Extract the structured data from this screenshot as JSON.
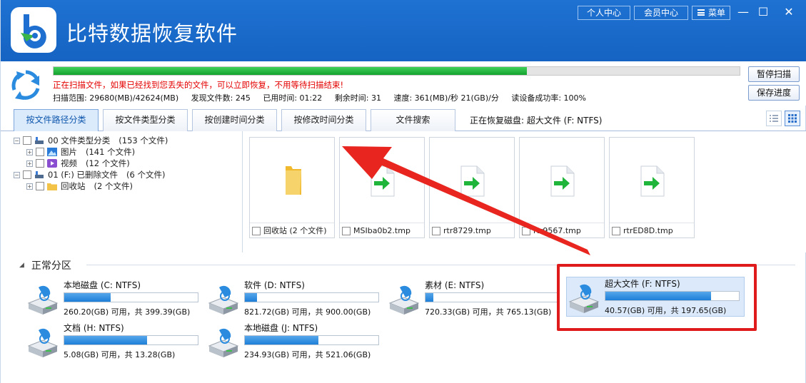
{
  "app": {
    "title": "比特数据恢复软件",
    "buttons": {
      "personal": "个人中心",
      "member": "会员中心",
      "menu": "菜单"
    }
  },
  "scan": {
    "progress": 0.69,
    "message": "正在扫描文件，如果已经找到您丢失的文件，可以立即恢复，不用等待扫描结束!",
    "stats": [
      "扫描范围: 29680(MB)/42624(MB)",
      "发现文件数: 245",
      "已用时间: 01:22",
      "剩余时间: 31",
      "速度: 361(MB)/秒  21(GB)/分",
      "读设备成功率: 100%"
    ],
    "pause_label": "暂停扫描",
    "save_label": "保存进度"
  },
  "tabs": [
    {
      "label": "按文件路径分类",
      "active": true
    },
    {
      "label": "按文件类型分类",
      "active": false
    },
    {
      "label": "按创建时间分类",
      "active": false
    },
    {
      "label": "按修改时间分类",
      "active": false
    },
    {
      "label": "文件搜索",
      "active": false
    }
  ],
  "recovering_text": "正在恢复磁盘: 超大文件 (F: NTFS)",
  "tree": [
    {
      "label": "00 文件类型分类",
      "count": "(153 个文件)",
      "icon": "drive-icon",
      "level": 0
    },
    {
      "label": "图片",
      "count": "(141 个文件)",
      "icon": "picture-icon",
      "level": 1
    },
    {
      "label": "视频",
      "count": "(12 个文件)",
      "icon": "video-icon",
      "level": 1
    },
    {
      "label": "01 (F:) 已删除文件",
      "count": "(6 个文件)",
      "icon": "drive-icon",
      "level": 0
    },
    {
      "label": "回收站",
      "count": "(2 个文件)",
      "icon": "folder-icon",
      "level": 1
    }
  ],
  "files": [
    {
      "name": "回收站 (2 个文件)",
      "icon": "folder-icon"
    },
    {
      "name": "MSIba0b2.tmp",
      "icon": "file-arrow-icon"
    },
    {
      "name": "rtr8729.tmp",
      "icon": "file-arrow-icon"
    },
    {
      "name": "rtr9567.tmp",
      "icon": "file-arrow-icon"
    },
    {
      "name": "rtrED8D.tmp",
      "icon": "file-arrow-icon"
    }
  ],
  "partitions": {
    "header": "正常分区",
    "drives": [
      {
        "name": "本地磁盘 (C: NTFS)",
        "free": "260.20(GB) 可用，共 399.39(GB)",
        "used_fraction": 0.35
      },
      {
        "name": "软件 (D: NTFS)",
        "free": "821.72(GB) 可用，共 900.00(GB)",
        "used_fraction": 0.09
      },
      {
        "name": "素材 (E: NTFS)",
        "free": "720.33(GB) 可用，共 765.13(GB)",
        "used_fraction": 0.06
      },
      {
        "name": "超大文件 (F: NTFS)",
        "free": "40.57(GB) 可用，共 197.65(GB)",
        "used_fraction": 0.79,
        "selected": true
      },
      {
        "name": "文档 (H: NTFS)",
        "free": "5.08(GB) 可用，共 13.28(GB)",
        "used_fraction": 0.62
      },
      {
        "name": "本地磁盘 (J: NTFS)",
        "free": "234.93(GB) 可用，共 521.06(GB)",
        "used_fraction": 0.55
      }
    ]
  },
  "colors": {
    "titlebar": "#1f72d2",
    "progress": "#14a22e",
    "warning": "#e40000",
    "annotation": "#e01b1b"
  }
}
